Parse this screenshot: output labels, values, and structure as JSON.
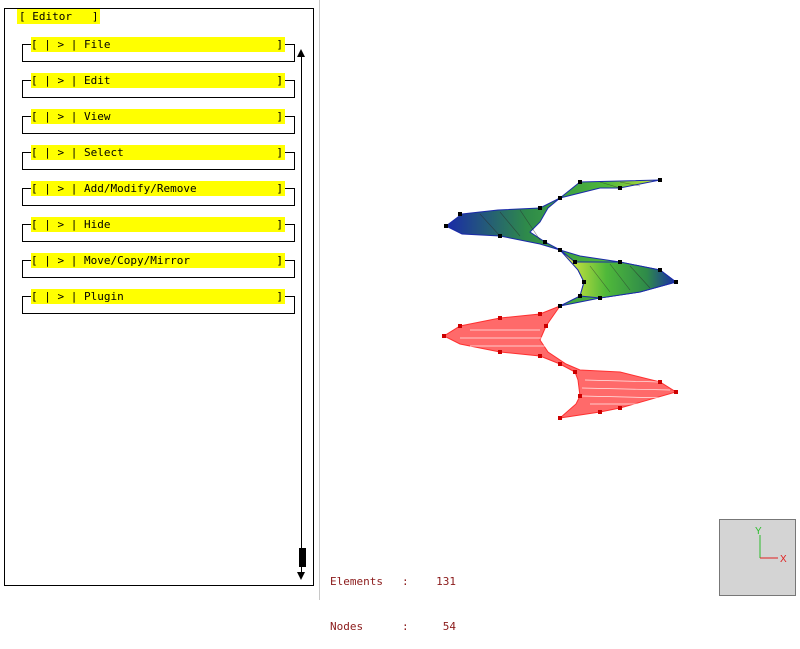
{
  "panel": {
    "title": "[ Editor   ]",
    "menu_items": [
      {
        "label": "[ | > | File"
      },
      {
        "label": "[ | > | Edit"
      },
      {
        "label": "[ | > | View"
      },
      {
        "label": "[ | > | Select"
      },
      {
        "label": "[ | > | Add/Modify/Remove"
      },
      {
        "label": "[ | > | Hide"
      },
      {
        "label": "[ | > | Move/Copy/Mirror"
      },
      {
        "label": "[ | > | Plugin"
      }
    ],
    "close_bracket": "]"
  },
  "stats": {
    "elements_label": "Elements",
    "elements_value": "131",
    "nodes_label": "Nodes",
    "nodes_value": "54",
    "separator": ":"
  },
  "axis": {
    "y_label": "Y",
    "x_label": "X",
    "y_color": "#2bbd2b",
    "x_color": "#e02020"
  },
  "colors": {
    "menu_bg": "#ffff00",
    "stats_text": "#8b1a1a",
    "mesh_red": "#ff6060",
    "mesh_blue": "#1a2aa8",
    "mesh_green": "#3aa83a",
    "mesh_yellow": "#f0f040"
  }
}
